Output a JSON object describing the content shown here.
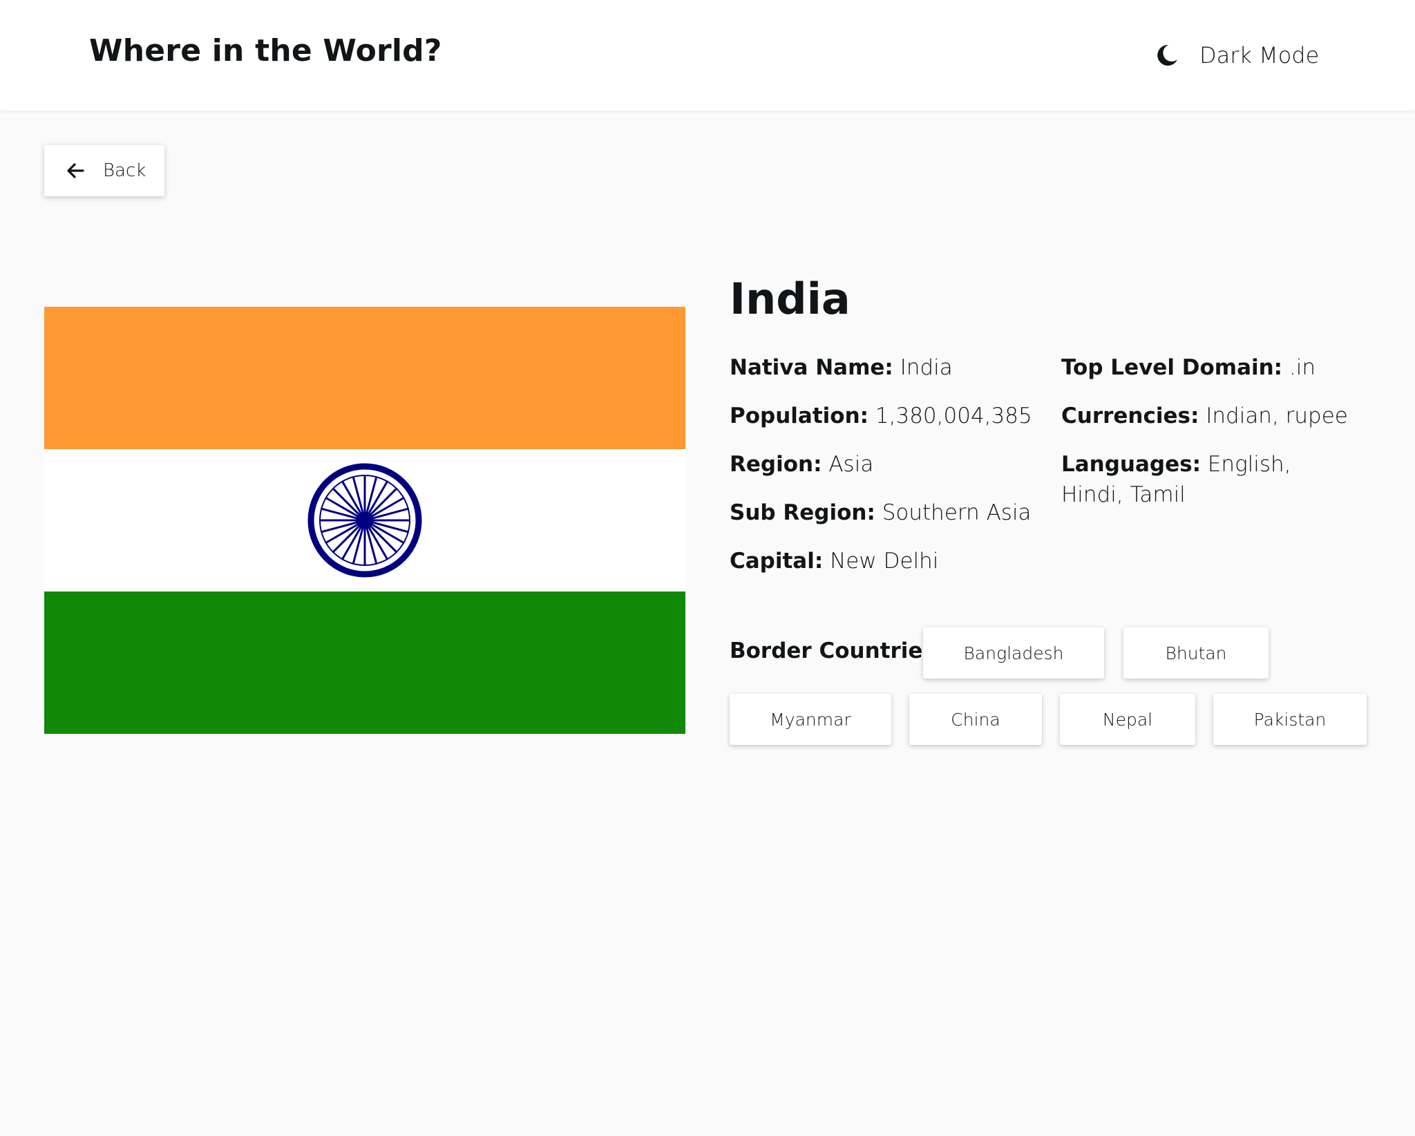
{
  "header": {
    "title": "Where in the World?",
    "theme_toggle": {
      "label": "Dark Mode",
      "icon": "moon-icon"
    }
  },
  "back_button": {
    "label": "Back",
    "icon": "arrow-left-icon"
  },
  "flag": {
    "icon": "india-flag",
    "colors": {
      "saffron": "#ff9933",
      "white": "#ffffff",
      "green": "#128807",
      "chakra": "#000080"
    }
  },
  "country": {
    "name": "India",
    "details_left": [
      {
        "key": "Nativa Name:",
        "value": "India"
      },
      {
        "key": "Population:",
        "value": "1,380,004,385"
      },
      {
        "key": "Region:",
        "value": "Asia"
      },
      {
        "key": "Sub Region:",
        "value": "Southern Asia"
      },
      {
        "key": "Capital:",
        "value": "New Delhi"
      }
    ],
    "details_right": [
      {
        "key": "Top Level Domain:",
        "value": ".in"
      },
      {
        "key": "Currencies:",
        "value": "Indian, rupee"
      },
      {
        "key": "Languages:",
        "value": "English, Hindi, Tamil"
      }
    ],
    "border_label": "Border Countries:",
    "border_countries": [
      "Bangladesh",
      "Bhutan",
      "Myanmar",
      "China",
      "Nepal",
      "Pakistan"
    ]
  }
}
